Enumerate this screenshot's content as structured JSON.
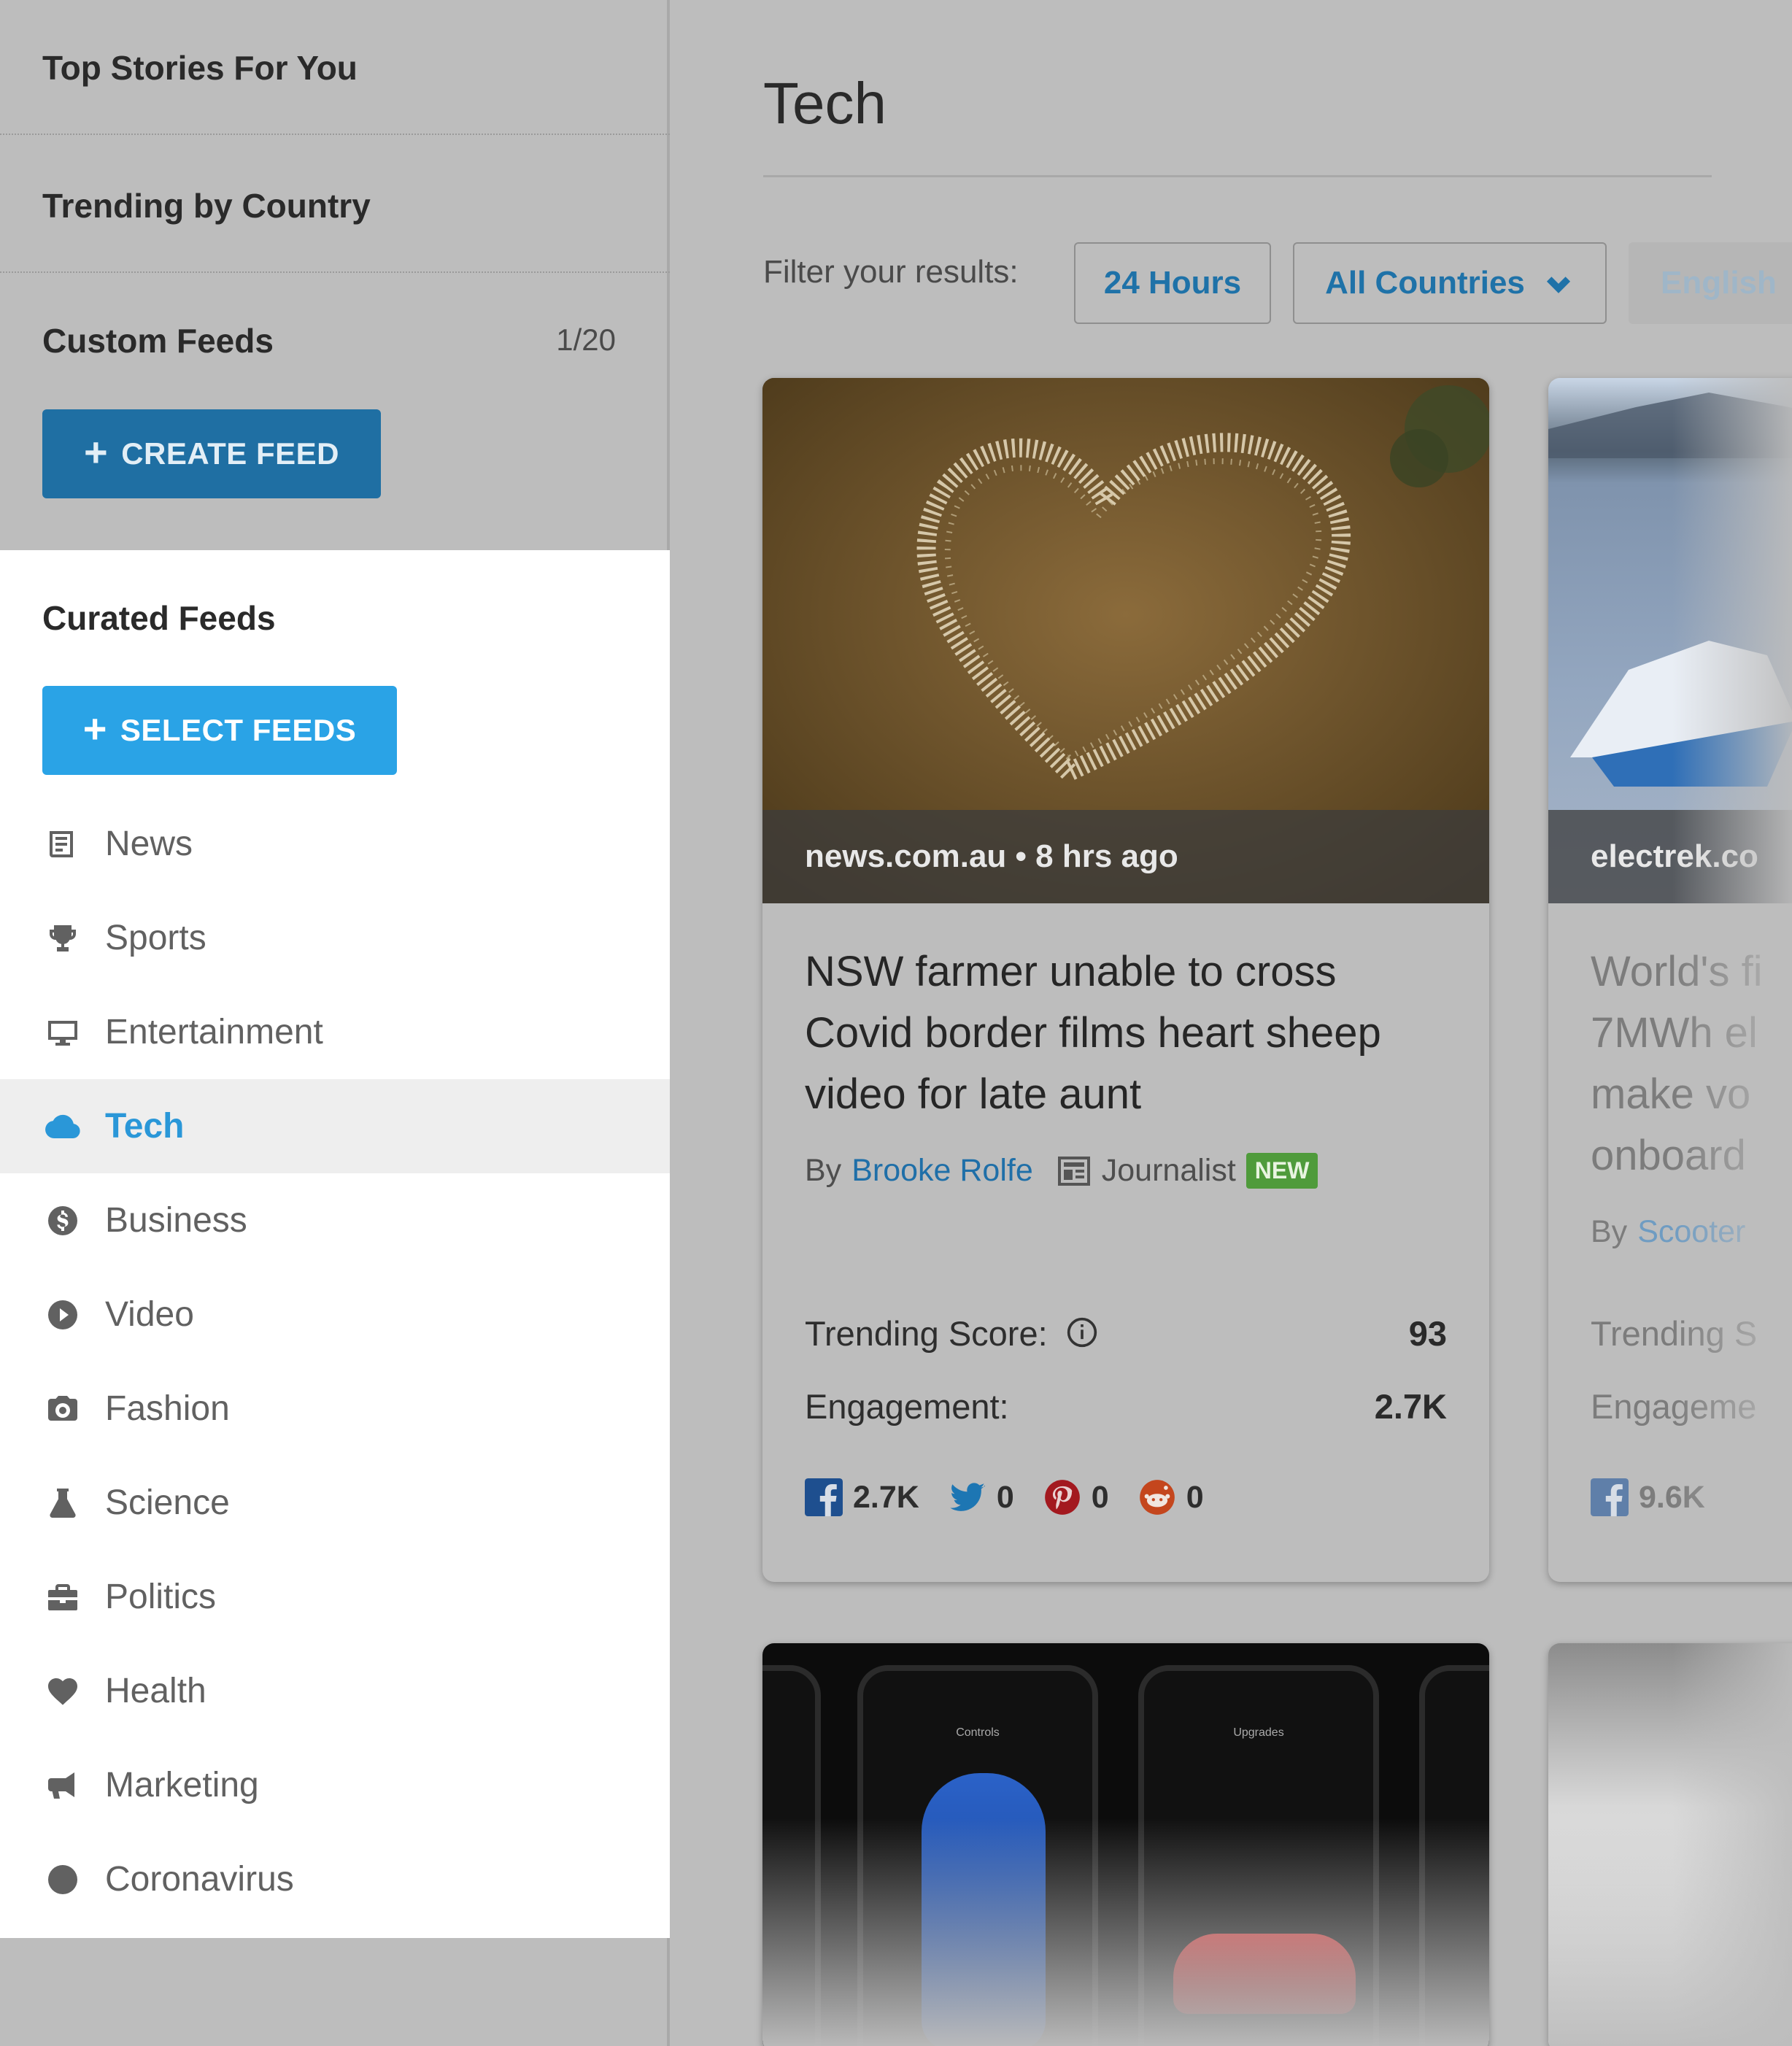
{
  "sidebar": {
    "top_stories": "Top Stories For You",
    "trending_country": "Trending by Country",
    "custom_feeds": {
      "heading": "Custom Feeds",
      "count": "1/20",
      "create_label": "CREATE FEED"
    },
    "curated_feeds": {
      "heading": "Curated Feeds",
      "select_label": "SELECT FEEDS"
    },
    "categories": [
      {
        "label": "News",
        "icon": "newspaper-icon"
      },
      {
        "label": "Sports",
        "icon": "trophy-icon"
      },
      {
        "label": "Entertainment",
        "icon": "monitor-icon"
      },
      {
        "label": "Tech",
        "icon": "cloud-icon",
        "active": true
      },
      {
        "label": "Business",
        "icon": "dollar-coin-icon"
      },
      {
        "label": "Video",
        "icon": "play-circle-icon"
      },
      {
        "label": "Fashion",
        "icon": "camera-icon"
      },
      {
        "label": "Science",
        "icon": "flask-icon"
      },
      {
        "label": "Politics",
        "icon": "briefcase-icon"
      },
      {
        "label": "Health",
        "icon": "heart-icon"
      },
      {
        "label": "Marketing",
        "icon": "megaphone-icon"
      },
      {
        "label": "Coronavirus",
        "icon": "circle-icon"
      }
    ]
  },
  "main": {
    "title": "Tech",
    "filter_label": "Filter your results:",
    "filters": {
      "time": "24 Hours",
      "country": "All Countries",
      "language": "English"
    }
  },
  "cards": [
    {
      "source": "news.com.au • 8 hrs ago",
      "headline": "NSW farmer unable to cross Covid border films heart sheep video for late aunt",
      "by": "By",
      "author": "Brooke Rolfe",
      "author_role": "Journalist",
      "badge": "NEW",
      "trending_label": "Trending Score:",
      "trending_value": "93",
      "engagement_label": "Engagement:",
      "engagement_value": "2.7K",
      "social": {
        "facebook": "2.7K",
        "twitter": "0",
        "pinterest": "0",
        "reddit": "0"
      }
    },
    {
      "source": "electrek.co",
      "headline": "World's fi 7MWh el make vo onboard",
      "by": "By",
      "author": "Scooter",
      "trending_label": "Trending S",
      "engagement_label": "Engageme",
      "social": {
        "facebook": "9.6K"
      }
    }
  ],
  "phone_screens": [
    "Controls",
    "Upgrades"
  ],
  "colors": {
    "accent_blue": "#2aa3e6",
    "dim_blue": "#1f6fa3",
    "new_badge": "#4f9b3b",
    "overlay_gray": "#bdbdbd"
  }
}
